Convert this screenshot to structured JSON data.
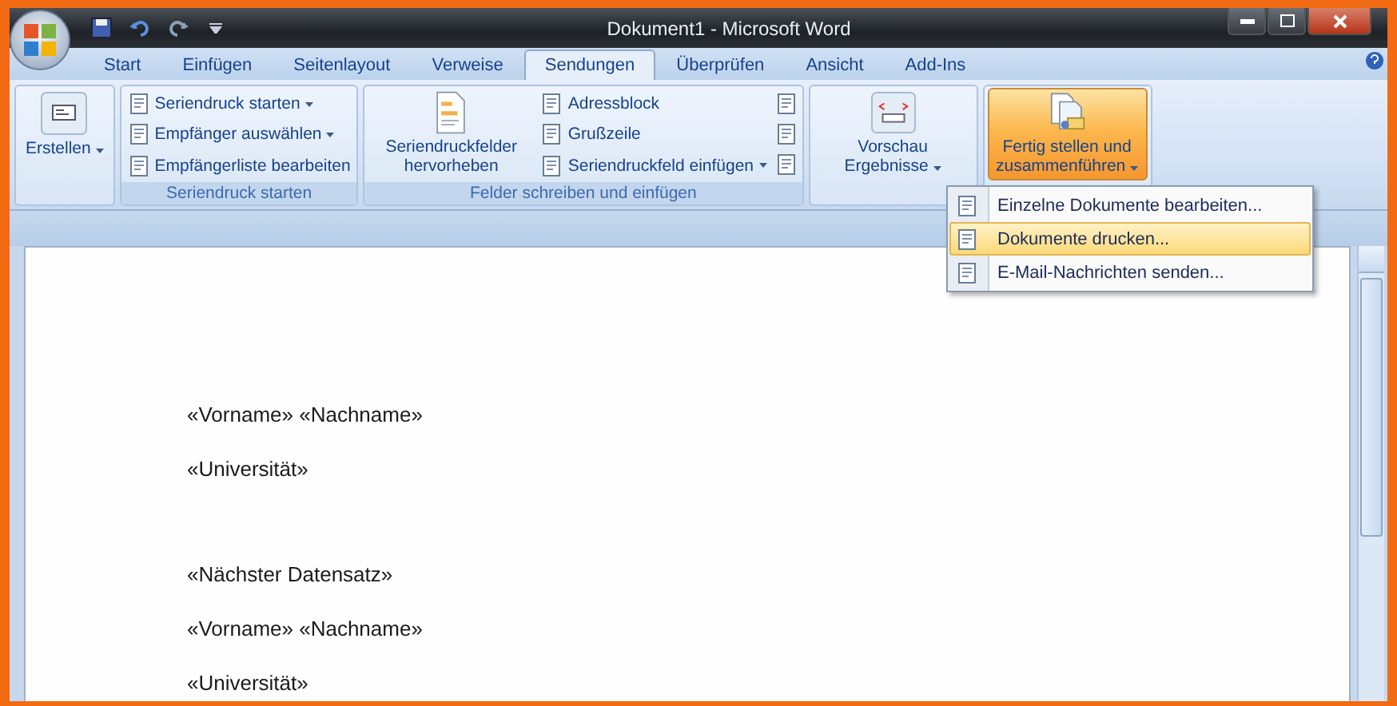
{
  "window": {
    "title": "Dokument1 - Microsoft Word"
  },
  "tabs": [
    {
      "label": "Start",
      "selected": false
    },
    {
      "label": "Einfügen",
      "selected": false
    },
    {
      "label": "Seitenlayout",
      "selected": false
    },
    {
      "label": "Verweise",
      "selected": false
    },
    {
      "label": "Sendungen",
      "selected": true
    },
    {
      "label": "Überprüfen",
      "selected": false
    },
    {
      "label": "Ansicht",
      "selected": false
    },
    {
      "label": "Add-Ins",
      "selected": false
    }
  ],
  "ribbon": {
    "groups": [
      {
        "buttons": [
          {
            "kind": "large",
            "label": "Erstellen",
            "dropdown": true,
            "selected": false
          }
        ]
      },
      {
        "label": "Seriendruck starten",
        "buttons": [
          {
            "kind": "small",
            "label": "Seriendruck starten",
            "dropdown": true
          },
          {
            "kind": "small",
            "label": "Empfänger auswählen",
            "dropdown": true
          },
          {
            "kind": "small",
            "label": "Empfängerliste bearbeiten",
            "dropdown": false
          }
        ]
      },
      {
        "label": "Felder schreiben und einfügen",
        "buttons": [
          {
            "kind": "large",
            "label": "Seriendruckfelder hervorheben",
            "dropdown": false,
            "selected": false
          },
          {
            "kind": "small",
            "label": "Adressblock",
            "dropdown": false
          },
          {
            "kind": "small",
            "label": "Grußzeile",
            "dropdown": false
          },
          {
            "kind": "small",
            "label": "Seriendruckfeld einfügen",
            "dropdown": true
          },
          {
            "kind": "icons"
          }
        ]
      },
      {
        "buttons": [
          {
            "kind": "large",
            "label": "Vorschau Ergebnisse",
            "dropdown": true,
            "selected": false
          }
        ]
      },
      {
        "buttons": [
          {
            "kind": "large",
            "label": "Fertig stellen und zusammenführen",
            "dropdown": true,
            "selected": true
          }
        ]
      }
    ]
  },
  "menu": {
    "items": [
      {
        "label": "Einzelne Dokumente bearbeiten...",
        "selected": false
      },
      {
        "label": "Dokumente drucken...",
        "selected": true
      },
      {
        "label": "E-Mail-Nachrichten senden...",
        "selected": false
      }
    ]
  },
  "document": {
    "blocks": [
      {
        "lines": [
          "«Vorname» «Nachname»",
          "«Universität»"
        ]
      },
      {
        "lines": [
          "«Nächster Datensatz»",
          "«Vorname» «Nachname»",
          "«Universität»"
        ]
      }
    ]
  }
}
